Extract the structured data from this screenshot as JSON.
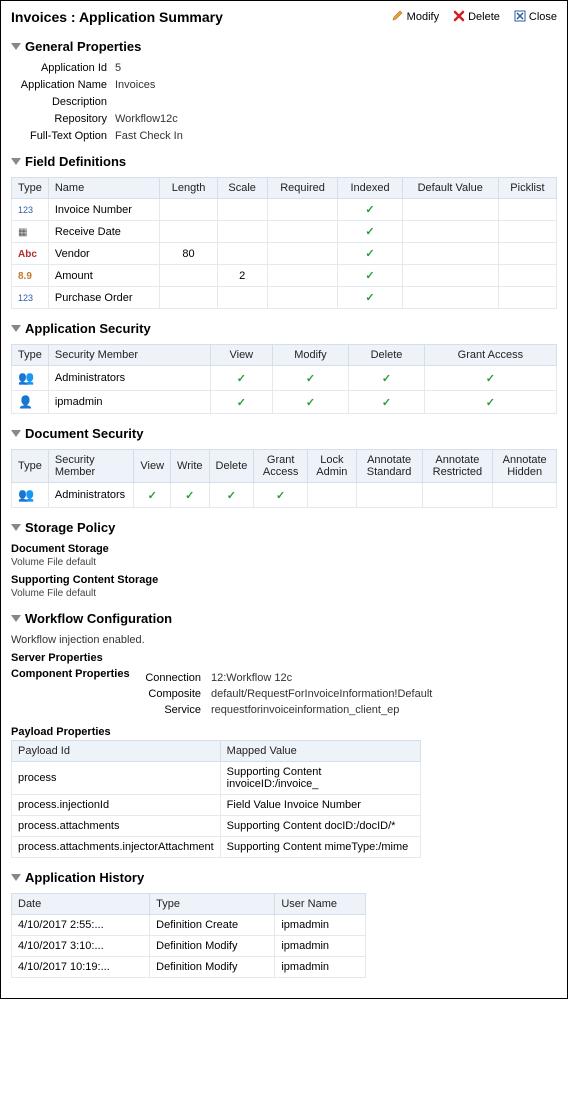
{
  "header": {
    "title": "Invoices : Application Summary",
    "modify": "Modify",
    "delete": "Delete",
    "close": "Close"
  },
  "general": {
    "heading": "General Properties",
    "rows": {
      "appid_k": "Application Id",
      "appid_v": "5",
      "appname_k": "Application Name",
      "appname_v": "Invoices",
      "desc_k": "Description",
      "desc_v": "",
      "repo_k": "Repository",
      "repo_v": "Workflow12c",
      "ft_k": "Full-Text Option",
      "ft_v": "Fast Check In"
    }
  },
  "fields": {
    "heading": "Field Definitions",
    "cols": {
      "c0": "Type",
      "c1": "Name",
      "c2": "Length",
      "c3": "Scale",
      "c4": "Required",
      "c5": "Indexed",
      "c6": "Default Value",
      "c7": "Picklist"
    },
    "r0": {
      "type": "123",
      "name": "Invoice Number",
      "length": "",
      "scale": "",
      "indexed": "✓"
    },
    "r1": {
      "type": "▦",
      "name": "Receive Date",
      "length": "",
      "scale": "",
      "indexed": "✓"
    },
    "r2": {
      "type": "Abc",
      "name": "Vendor",
      "length": "80",
      "scale": "",
      "indexed": "✓"
    },
    "r3": {
      "type": "8.9",
      "name": "Amount",
      "length": "",
      "scale": "2",
      "indexed": "✓"
    },
    "r4": {
      "type": "123",
      "name": "Purchase Order",
      "length": "",
      "scale": "",
      "indexed": "✓"
    }
  },
  "appsec": {
    "heading": "Application Security",
    "cols": {
      "c0": "Type",
      "c1": "Security Member",
      "c2": "View",
      "c3": "Modify",
      "c4": "Delete",
      "c5": "Grant Access"
    },
    "r0": {
      "member": "Administrators",
      "view": "✓",
      "modify": "✓",
      "delete": "✓",
      "grant": "✓"
    },
    "r1": {
      "member": "ipmadmin",
      "view": "✓",
      "modify": "✓",
      "delete": "✓",
      "grant": "✓"
    }
  },
  "docsec": {
    "heading": "Document Security",
    "cols": {
      "c0": "Type",
      "c1": "Security Member",
      "c2": "View",
      "c3": "Write",
      "c4": "Delete",
      "c5": "Grant Access",
      "c6": "Lock Admin",
      "c7": "Annotate Standard",
      "c8": "Annotate Restricted",
      "c9": "Annotate Hidden"
    },
    "r0": {
      "member": "Administrators",
      "view": "✓",
      "write": "✓",
      "delete": "✓",
      "grant": "✓"
    }
  },
  "storage": {
    "heading": "Storage Policy",
    "doc_h": "Document Storage",
    "doc_line": "Volume  File default",
    "sup_h": "Supporting Content Storage",
    "sup_line": "Volume  File default"
  },
  "workflow": {
    "heading": "Workflow Configuration",
    "inj": "Workflow injection enabled.",
    "server_h": "Server Properties",
    "comp_h": "Component Properties",
    "conn_k": "Connection",
    "conn_v": "12:Workflow 12c",
    "compo_k": "Composite",
    "compo_v": "default/RequestForInvoiceInformation!Default",
    "svc_k": "Service",
    "svc_v": "requestforinvoiceinformation_client_ep",
    "payload_h": "Payload Properties",
    "pcols": {
      "c0": "Payload Id",
      "c1": "Mapped Value"
    },
    "p0": {
      "id": "process",
      "mv": "Supporting Content invoiceID:/invoice_"
    },
    "p1": {
      "id": "process.injectionId",
      "mv": "Field Value  Invoice Number"
    },
    "p2": {
      "id": "process.attachments",
      "mv": "Supporting Content  docID:/docID/*"
    },
    "p3": {
      "id": "process.attachments.injectorAttachment",
      "mv": "Supporting Content  mimeType:/mime"
    }
  },
  "history": {
    "heading": "Application History",
    "cols": {
      "c0": "Date",
      "c1": "Type",
      "c2": "User Name"
    },
    "r0": {
      "d": "4/10/2017 2:55:...",
      "t": "Definition Create",
      "u": "ipmadmin"
    },
    "r1": {
      "d": "4/10/2017 3:10:...",
      "t": "Definition Modify",
      "u": "ipmadmin"
    },
    "r2": {
      "d": "4/10/2017 10:19:...",
      "t": "Definition Modify",
      "u": "ipmadmin"
    }
  }
}
